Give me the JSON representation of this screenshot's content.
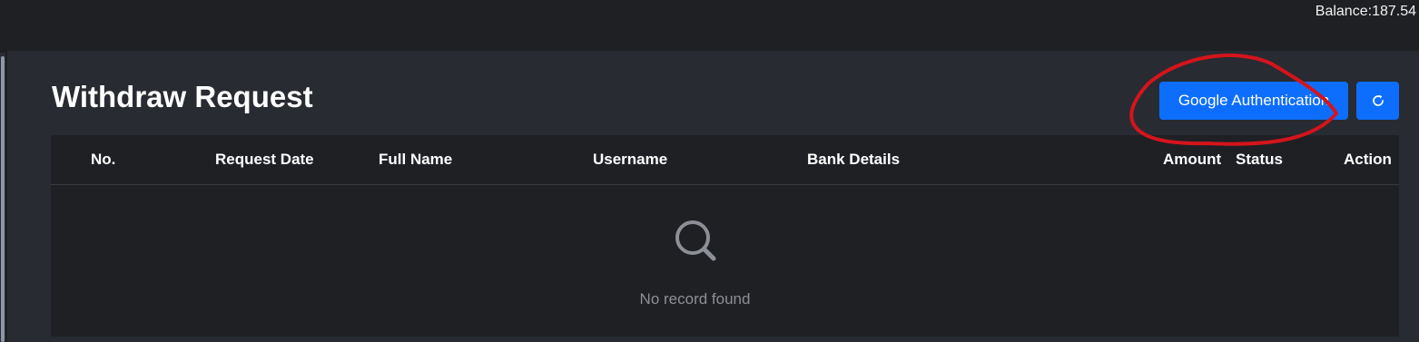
{
  "header": {
    "balance_label": "Balance",
    "balance_separator": ":",
    "balance_value": "187.54"
  },
  "page": {
    "title": "Withdraw Request"
  },
  "toolbar": {
    "google_auth_label": "Google Authentication",
    "refresh_icon": "refresh-icon"
  },
  "table": {
    "columns": [
      "No.",
      "Request Date",
      "Full Name",
      "Username",
      "Bank Details",
      "Amount",
      "Status",
      "Action"
    ],
    "rows": [],
    "empty_icon": "search-icon",
    "empty_message": "No record found"
  },
  "colors": {
    "primary": "#0d6efd",
    "panel": "#282b31",
    "table_bg": "#1f2024",
    "annotation": "#d4141c"
  }
}
